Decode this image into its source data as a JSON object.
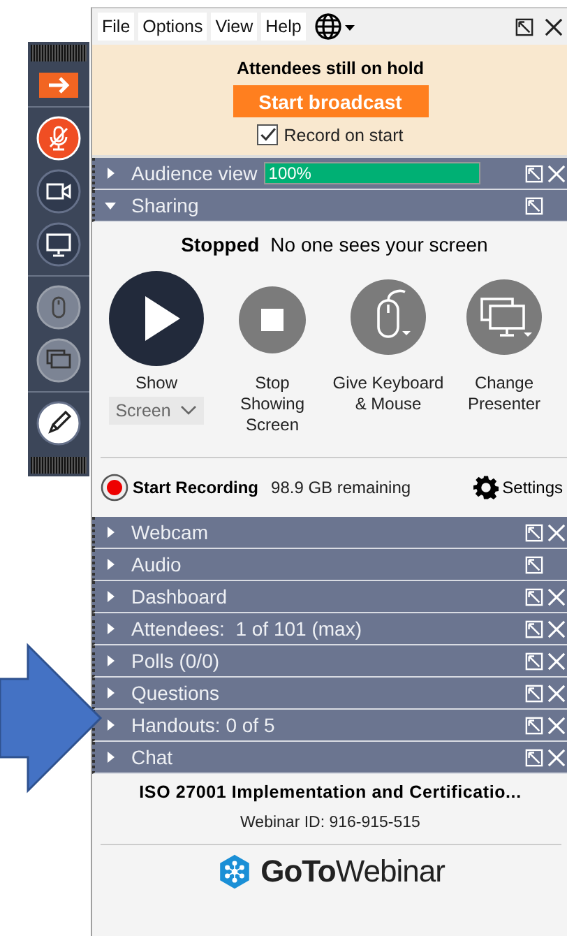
{
  "toolbar": [
    {
      "kind": "arrow",
      "disabled": false
    },
    {
      "kind": "mic",
      "disabled": false,
      "muted": true
    },
    {
      "kind": "camera",
      "disabled": false
    },
    {
      "kind": "screen",
      "disabled": false
    },
    {
      "kind": "mouse",
      "disabled": true
    },
    {
      "kind": "presenter",
      "disabled": true
    },
    {
      "kind": "pen",
      "disabled": false
    }
  ],
  "menu": [
    "File",
    "Options",
    "View",
    "Help"
  ],
  "hold": {
    "title": "Attendees still on hold",
    "button": "Start broadcast",
    "record": {
      "label": "Record on start",
      "checked": true
    }
  },
  "top_panels": [
    {
      "label": "Audience view",
      "expanded": false,
      "closable": true,
      "meter": {
        "level": 1,
        "reading": "100%"
      }
    },
    {
      "label": "Sharing",
      "expanded": true,
      "closable": false
    }
  ],
  "sharing": {
    "status": "Stopped",
    "message": "No one sees your screen",
    "actions": [
      {
        "kind": "play",
        "label": "Show",
        "dropdown": "Screen"
      },
      {
        "kind": "stop",
        "label": "Stop Showing Screen"
      },
      {
        "kind": "mouse",
        "label": "Give Keyboard & Mouse"
      },
      {
        "kind": "presenter",
        "label": "Change Presenter"
      }
    ],
    "recording": {
      "label": "Start Recording",
      "remaining": "98.9 GB remaining"
    },
    "settings": "Settings"
  },
  "panels": [
    {
      "label": "Webcam",
      "expanded": false,
      "closable": true
    },
    {
      "label": "Audio",
      "expanded": false,
      "closable": false
    },
    {
      "label": "Dashboard",
      "expanded": false,
      "closable": true
    },
    {
      "label": "Attendees:  1 of 101 (max)",
      "expanded": false,
      "closable": true
    },
    {
      "label": "Polls (0/0)",
      "expanded": false,
      "closable": true
    },
    {
      "label": "Questions",
      "expanded": false,
      "closable": true
    },
    {
      "label": "Handouts: 0 of 5",
      "expanded": false,
      "closable": true
    },
    {
      "label": "Chat",
      "expanded": false,
      "closable": true
    }
  ],
  "footer": {
    "title": "ISO 27001 Implementation and Certificatio...",
    "webinar_id": "Webinar ID: 916-915-515",
    "logo_bold": "GoTo",
    "logo_light": "Webinar"
  }
}
